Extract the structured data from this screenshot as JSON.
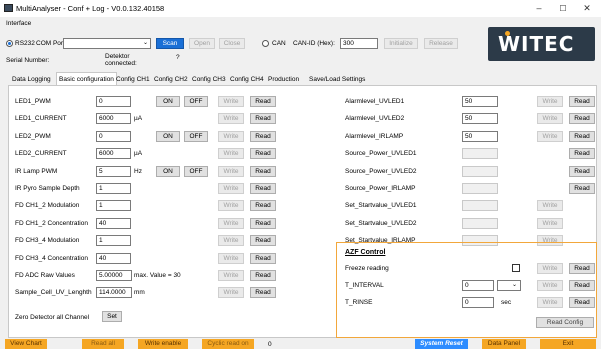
{
  "window": {
    "title": "MultiAnalyser - Conf + Log - V0.0.132.40158",
    "min": "–",
    "max": "☐",
    "close": "✕"
  },
  "interface": {
    "group_label": "Interface",
    "rs232_label": "RS232",
    "com_port_label": "COM Port",
    "com_port_value": "",
    "scan": "Scan",
    "open": "Open",
    "close": "Close",
    "can_label": "CAN",
    "can_id_label": "CAN-ID (Hex):",
    "can_id_value": "300",
    "initialize": "Initialize",
    "release": "Release",
    "serial_label": "Serial Number:",
    "detektor_label": "Detektor connected:",
    "detektor_value": "?"
  },
  "logo": {
    "text": "WITEC"
  },
  "tabs": [
    "Data Logging",
    "Basic configuration",
    "Config CH1",
    "Config CH2",
    "Config CH3",
    "Config CH4",
    "Production",
    "Save/Load Settings"
  ],
  "left_rows": [
    {
      "label": "LED1_PWM",
      "value": "0",
      "unit": "",
      "on": "ON",
      "off": "OFF",
      "write": "Write",
      "read": "Read"
    },
    {
      "label": "LED1_CURRENT",
      "value": "6000",
      "unit": "µA",
      "write": "Write",
      "read": "Read"
    },
    {
      "label": "LED2_PWM",
      "value": "0",
      "unit": "",
      "on": "ON",
      "off": "OFF",
      "write": "Write",
      "read": "Read"
    },
    {
      "label": "LED2_CURRENT",
      "value": "6000",
      "unit": "µA",
      "write": "Write",
      "read": "Read"
    },
    {
      "label": "IR Lamp PWM",
      "value": "5",
      "unit": "Hz",
      "on": "ON",
      "off": "OFF",
      "write": "Write",
      "read": "Read"
    },
    {
      "label": "IR Pyro Sample Depth",
      "value": "1",
      "unit": "",
      "write": "Write",
      "read": "Read"
    },
    {
      "label": "FD CH1_2 Modulation",
      "value": "1",
      "unit": "",
      "write": "Write",
      "read": "Read"
    },
    {
      "label": "FD CH1_2 Concentration",
      "value": "40",
      "unit": "",
      "write": "Write",
      "read": "Read"
    },
    {
      "label": "FD CH3_4 Modulation",
      "value": "1",
      "unit": "",
      "write": "Write",
      "read": "Read"
    },
    {
      "label": "FD CH3_4 Concentration",
      "value": "40",
      "unit": "",
      "write": "Write",
      "read": "Read"
    },
    {
      "label": "FD ADC Raw Values",
      "value": "5.00000",
      "unit": "max. Value = 30",
      "write": "Write",
      "read": "Read"
    },
    {
      "label": "Sample_Cell_UV_Lenghth",
      "value": "114.0000",
      "unit": "mm",
      "write": "Write",
      "read": "Read"
    }
  ],
  "zero_detector": {
    "label": "Zero Detector all Channel",
    "button": "Set"
  },
  "right_rows": [
    {
      "label": "Alarmlevel_UVLED1",
      "value": "50",
      "write": "Write",
      "read": "Read"
    },
    {
      "label": "Alarmlevel_UVLED2",
      "value": "50",
      "write": "Write",
      "read": "Read"
    },
    {
      "label": "Alarmlevel_IRLAMP",
      "value": "50",
      "write": "Write",
      "read": "Read"
    },
    {
      "label": "Source_Power_UVLED1",
      "value": "",
      "read": "Read"
    },
    {
      "label": "Source_Power_UVLED2",
      "value": "",
      "read": "Read"
    },
    {
      "label": "Source_Power_IRLAMP",
      "value": "",
      "read": "Read"
    },
    {
      "label": "Set_Startvalue_UVLED1",
      "value": "",
      "write": "Write"
    },
    {
      "label": "Set_Startvalue_UVLED2",
      "value": "",
      "write": "Write"
    },
    {
      "label": "Set_Startvalue_IRLAMP",
      "value": "",
      "write": "Write"
    }
  ],
  "azf": {
    "title": "AZF Control",
    "freeze_label": "Freeze reading",
    "t_interval_label": "T_INTERVAL",
    "t_interval_value": "0",
    "t_rinse_label": "T_RINSE",
    "t_rinse_value": "0",
    "t_rinse_unit": "sec",
    "write": "Write",
    "read": "Read",
    "read_config": "Read Config"
  },
  "bottom": {
    "view_chart": "View Chart",
    "read_all": "Read all",
    "write_enable": "Write enable",
    "cyclic_read_on": "Cyclic read on",
    "cyclic_count": "0",
    "system_reset": "System Reset",
    "data_panel": "Data Panel",
    "exit": "Exit"
  },
  "colors": {
    "accent_orange": "#f5a623",
    "reset_blue": "#2d8cff",
    "scan_blue": "#1a6fd6",
    "logo_bg": "#2c3a48"
  }
}
